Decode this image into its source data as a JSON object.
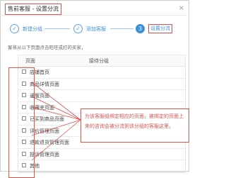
{
  "dialog": {
    "title": "售前客服 - 设置分流",
    "close_glyph": "×"
  },
  "steps": [
    {
      "label": "新建分组",
      "state": "done",
      "glyph": "✓"
    },
    {
      "label": "添加客服",
      "state": "done",
      "glyph": "✓"
    },
    {
      "label": "设置分流",
      "state": "current",
      "glyph": "3"
    }
  ],
  "notice": "客将从以下页面点击旺旺或打的买家，",
  "table": {
    "headers": [
      "页面",
      "接待分组"
    ],
    "rows": [
      "店铺首页",
      "商品详情页面",
      "通版页面",
      "收藏夹页面",
      "已买到商品页面",
      "评价管理页面",
      "退款退货管理页面",
      "投诉管理页面",
      "其他"
    ]
  },
  "callout": {
    "text": "为该客服组绑定相应的页面，被绑定的页面上来的咨询会被分流到该分组的客服这里。"
  },
  "colors": {
    "accent": "#3c8fd8",
    "highlight": "#d9534f"
  }
}
